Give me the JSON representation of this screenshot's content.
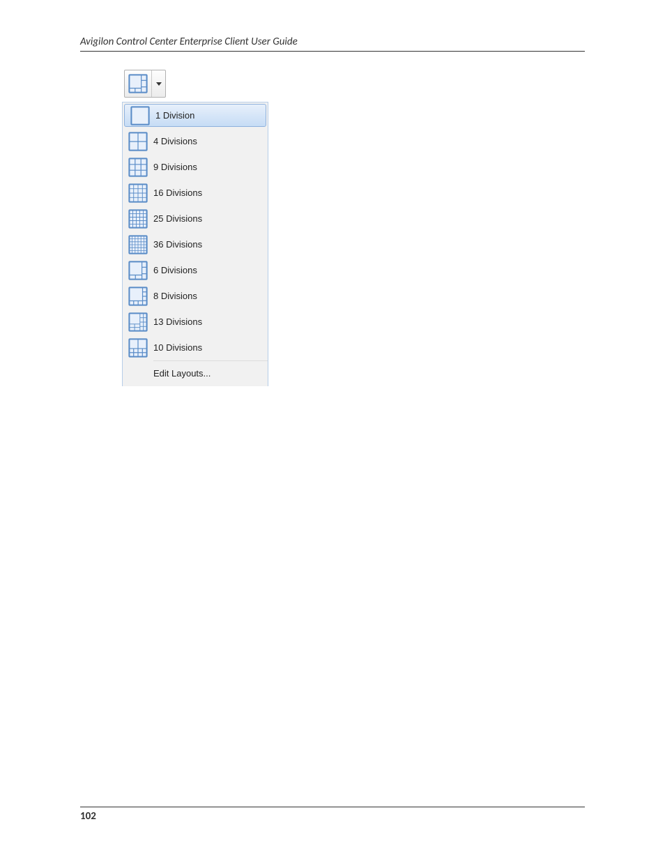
{
  "header": {
    "title": "Avigilon Control Center Enterprise Client User Guide"
  },
  "menu": {
    "items": [
      {
        "label": "1 Division",
        "icon": "layout-1",
        "selected": true
      },
      {
        "label": "4 Divisions",
        "icon": "layout-4",
        "selected": false
      },
      {
        "label": "9 Divisions",
        "icon": "layout-9",
        "selected": false
      },
      {
        "label": "16 Divisions",
        "icon": "layout-16",
        "selected": false
      },
      {
        "label": "25 Divisions",
        "icon": "layout-25",
        "selected": false
      },
      {
        "label": "36 Divisions",
        "icon": "layout-36",
        "selected": false
      },
      {
        "label": "6 Divisions",
        "icon": "layout-6",
        "selected": false
      },
      {
        "label": "8 Divisions",
        "icon": "layout-8",
        "selected": false
      },
      {
        "label": "13 Divisions",
        "icon": "layout-13",
        "selected": false
      },
      {
        "label": "10 Divisions",
        "icon": "layout-10",
        "selected": false
      }
    ],
    "editLabel": "Edit Layouts..."
  },
  "footer": {
    "page": "102"
  }
}
